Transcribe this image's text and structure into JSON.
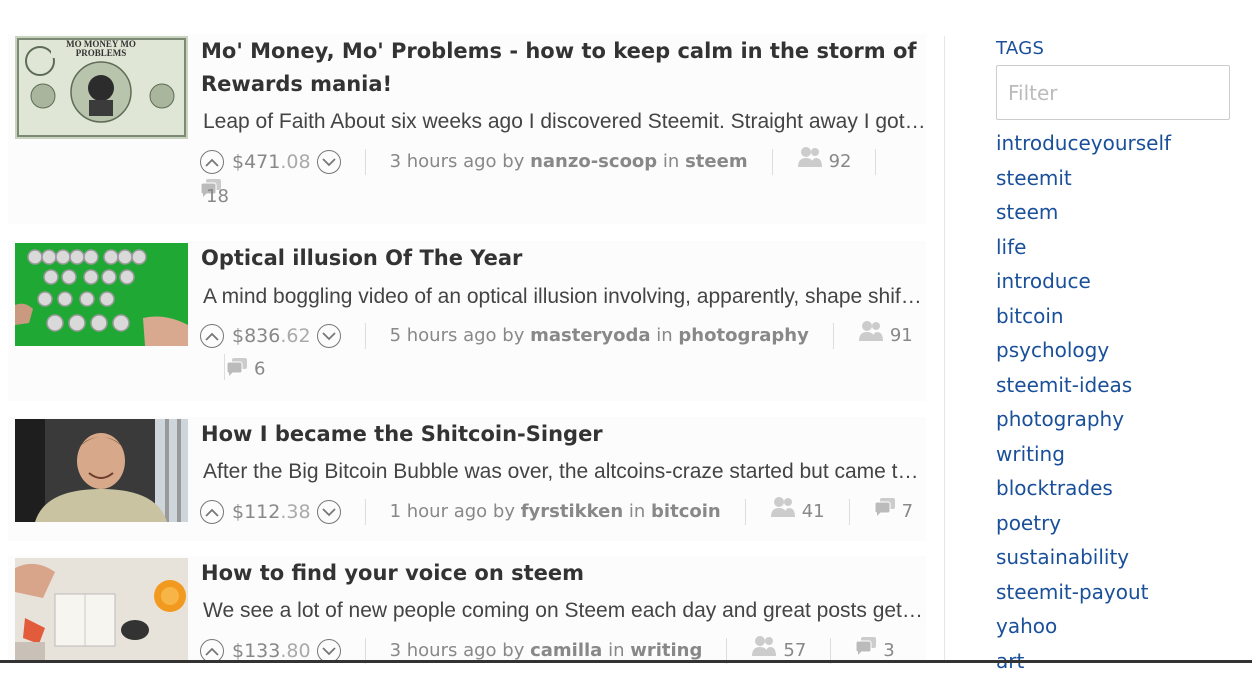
{
  "posts": [
    {
      "title_line1": "Mo' Money, Mo' Problems - how to keep calm in the storm of",
      "title_line2": "Rewards mania!",
      "summary": "Leap of Faith About six weeks ago I discovered Steemit. Straight away I got really excited and have spent pretty much every waking",
      "payout_main": "$471",
      "payout_cents": ".08",
      "time": "3 hours ago by",
      "author": "nanzo-scoop",
      "in": "in",
      "category": "steem",
      "voters": "92",
      "comments": "18",
      "thumb_text": "MO MONEY MO PROBLEMS"
    },
    {
      "title_line1": "Optical illusion Of The Year",
      "summary": "A mind boggling video of an optical illusion involving, apparently, shape shifting tubes that change when seen in a mirror",
      "payout_main": "$836",
      "payout_cents": ".62",
      "time": "5 hours ago by",
      "author": "masteryoda",
      "in": "in",
      "category": "photography",
      "voters": "91",
      "comments": "6"
    },
    {
      "title_line1": "How I became the Shitcoin-Singer",
      "summary": "After the Big Bitcoin Bubble was over, the altcoins-craze started but came to a standstill quickly",
      "payout_main": "$112",
      "payout_cents": ".38",
      "time": "1 hour ago by",
      "author": "fyrstikken",
      "in": "in",
      "category": "bitcoin",
      "voters": "41",
      "comments": "7"
    },
    {
      "title_line1": "How to find your voice on steem",
      "summary": "We see a lot of new people coming on Steem each day and great posts getting lost in the flow",
      "payout_main": "$133",
      "payout_cents": ".80",
      "time": "3 hours ago by",
      "author": "camilla",
      "in": "in",
      "category": "writing",
      "voters": "57",
      "comments": "3"
    }
  ],
  "sidebar": {
    "heading": "TAGS",
    "filter_placeholder": "Filter",
    "tags": [
      "introduceyourself",
      "steemit",
      "steem",
      "life",
      "introduce",
      "bitcoin",
      "psychology",
      "steemit-ideas",
      "photography",
      "writing",
      "blocktrades",
      "poetry",
      "sustainability",
      "steemit-payout",
      "yahoo",
      "art"
    ]
  },
  "icons": {
    "upvote": "chevron-up-circle-icon",
    "downvote": "chevron-down-circle-icon",
    "voters": "people-icon",
    "comments": "comment-bubbles-icon"
  },
  "colors": {
    "link": "#1a5099",
    "meta": "#888888",
    "title": "#333333"
  }
}
